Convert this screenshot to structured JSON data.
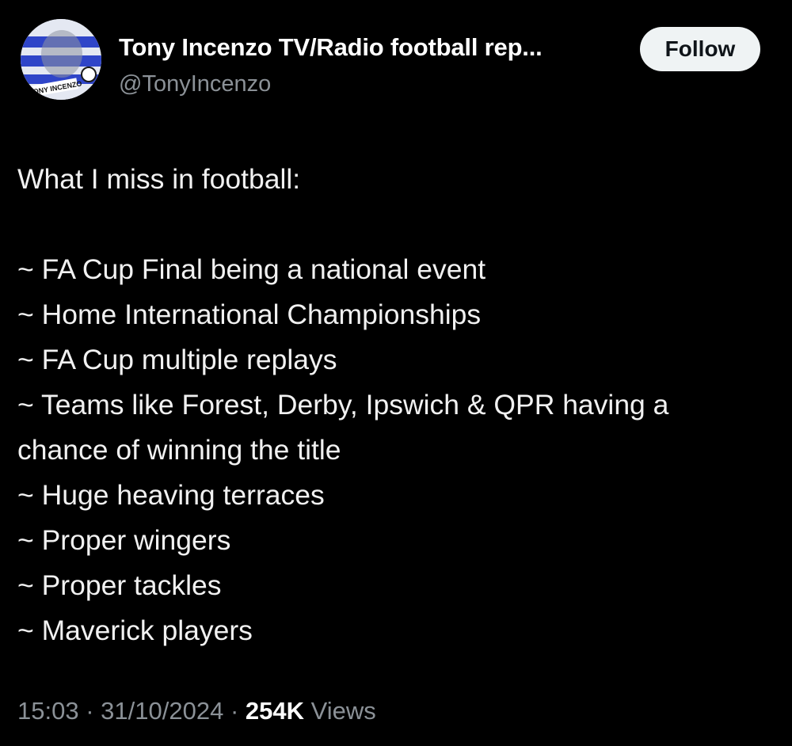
{
  "author": {
    "display_name": "Tony Incenzo TV/Radio football rep...",
    "handle": "@TonyIncenzo",
    "avatar_badge_text": "TONY INCENZO"
  },
  "follow_button": {
    "label": "Follow"
  },
  "tweet": {
    "lines": [
      "What I miss in football:",
      "",
      "~ FA Cup Final being a national event",
      "~ Home International Championships",
      "~ FA Cup multiple replays",
      "~ Teams like Forest, Derby, Ipswich & QPR having a",
      "chance of winning the title",
      "~ Huge heaving terraces",
      "~ Proper wingers",
      "~ Proper tackles",
      "~ Maverick players"
    ]
  },
  "meta": {
    "time": "15:03",
    "separator": "·",
    "date": "31/10/2024",
    "views_count": "254K",
    "views_label": "Views"
  },
  "colors": {
    "background": "#000000",
    "text_primary": "#ffffff",
    "text_secondary": "#8b9197",
    "button_bg": "#eff3f4",
    "avatar_stripe_blue": "#2f45c8"
  }
}
